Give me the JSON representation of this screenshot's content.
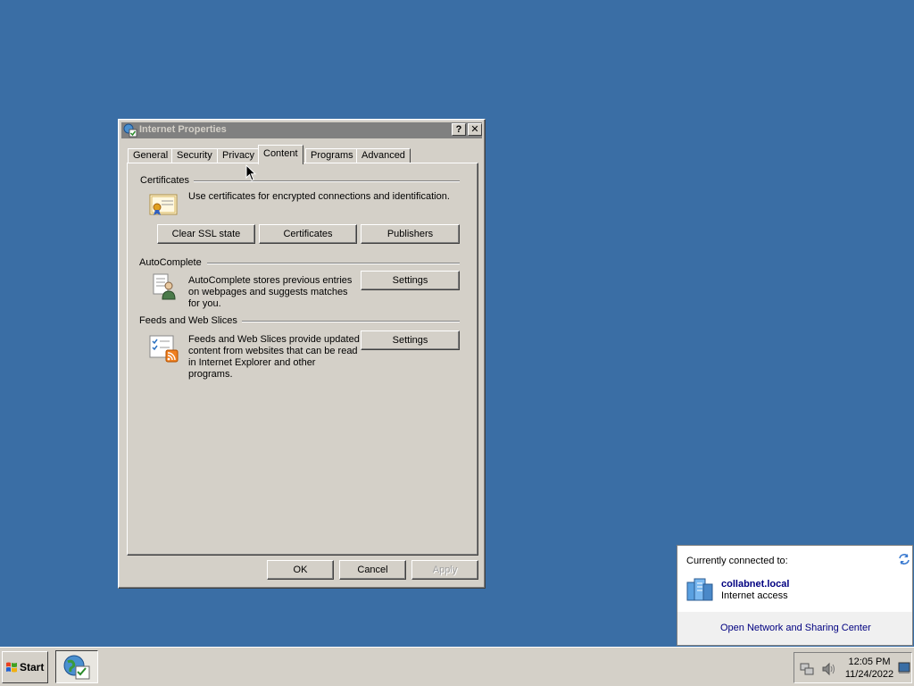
{
  "window": {
    "title": "Internet Properties",
    "help_label": "?",
    "close_label": "✕"
  },
  "tabs": [
    {
      "label": "General"
    },
    {
      "label": "Security"
    },
    {
      "label": "Privacy"
    },
    {
      "label": "Content",
      "active": true
    },
    {
      "label": "Programs"
    },
    {
      "label": "Advanced"
    }
  ],
  "certificates": {
    "heading": "Certificates",
    "description": "Use certificates for encrypted connections and identification.",
    "clear_ssl_label": "Clear SSL state",
    "certificates_label": "Certificates",
    "publishers_label": "Publishers"
  },
  "autocomplete": {
    "heading": "AutoComplete",
    "description": "AutoComplete stores previous entries on webpages and suggests matches for you.",
    "settings_label": "Settings"
  },
  "feeds": {
    "heading": "Feeds and Web Slices",
    "description": "Feeds and Web Slices provide updated content from websites that can be read in Internet Explorer and other programs.",
    "settings_label": "Settings"
  },
  "dialog_buttons": {
    "ok_label": "OK",
    "cancel_label": "Cancel",
    "apply_label": "Apply"
  },
  "network_popup": {
    "header": "Currently connected to:",
    "network_name": "collabnet.local",
    "status": "Internet access",
    "link": "Open Network and Sharing Center"
  },
  "taskbar": {
    "start_label": "Start",
    "time": "12:05 PM",
    "date": "11/24/2022"
  },
  "colors": {
    "desktop": "#3a6ea5",
    "link": "#000080",
    "inactive_title": "#808080"
  }
}
